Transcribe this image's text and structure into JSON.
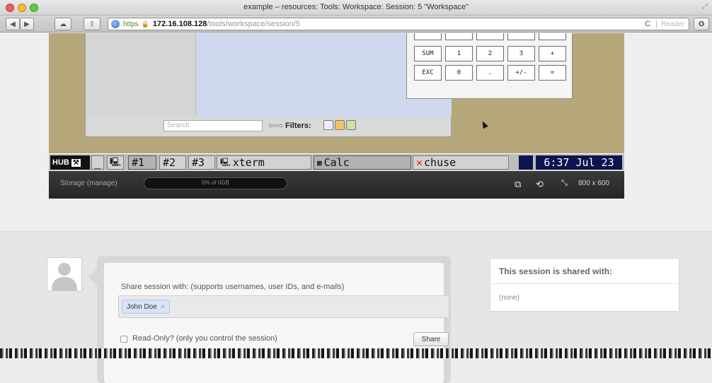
{
  "window": {
    "title": "example – resources: Tools: Workspace: Session: 5 \"Workspace\""
  },
  "toolbar": {
    "url_https": "https",
    "url_host": "172.16.108.128",
    "url_path": "/tools/workspace/session/5",
    "reader_label": "Reader"
  },
  "session": {
    "workspace_window": {
      "search_placeholder": "Search",
      "filters_label": "Filters:"
    },
    "calculator": {
      "rows": [
        [
          "SUM",
          "1",
          "2",
          "3",
          "+"
        ],
        [
          "EXC",
          "0",
          ".",
          "+/-",
          "="
        ]
      ]
    },
    "taskbar": {
      "logo": "HUB",
      "items": [
        "#1",
        "#2",
        "#3",
        "xterm",
        "Calc",
        "chuse"
      ],
      "clock": "6:37 Jul 23"
    },
    "statusbar": {
      "storage_label": "Storage (manage)",
      "storage_text": "0% of 0GB",
      "storage_fraction": 0,
      "resolution": "800 x 600"
    }
  },
  "sharing": {
    "label": "Share session with: (supports usernames, user IDs, and e-mails)",
    "token": "John Doe",
    "token_remove": "×",
    "readonly_label": "Read-Only? (only you control the session)",
    "share_button": "Share",
    "shared_with_title": "This session is shared with:",
    "shared_with_value": "(none)"
  },
  "colors": {
    "desktop": "#b6a77a",
    "clock_bg": "#0c154f",
    "statusbar": "#2d2d2d",
    "close_x": "#e02020"
  }
}
